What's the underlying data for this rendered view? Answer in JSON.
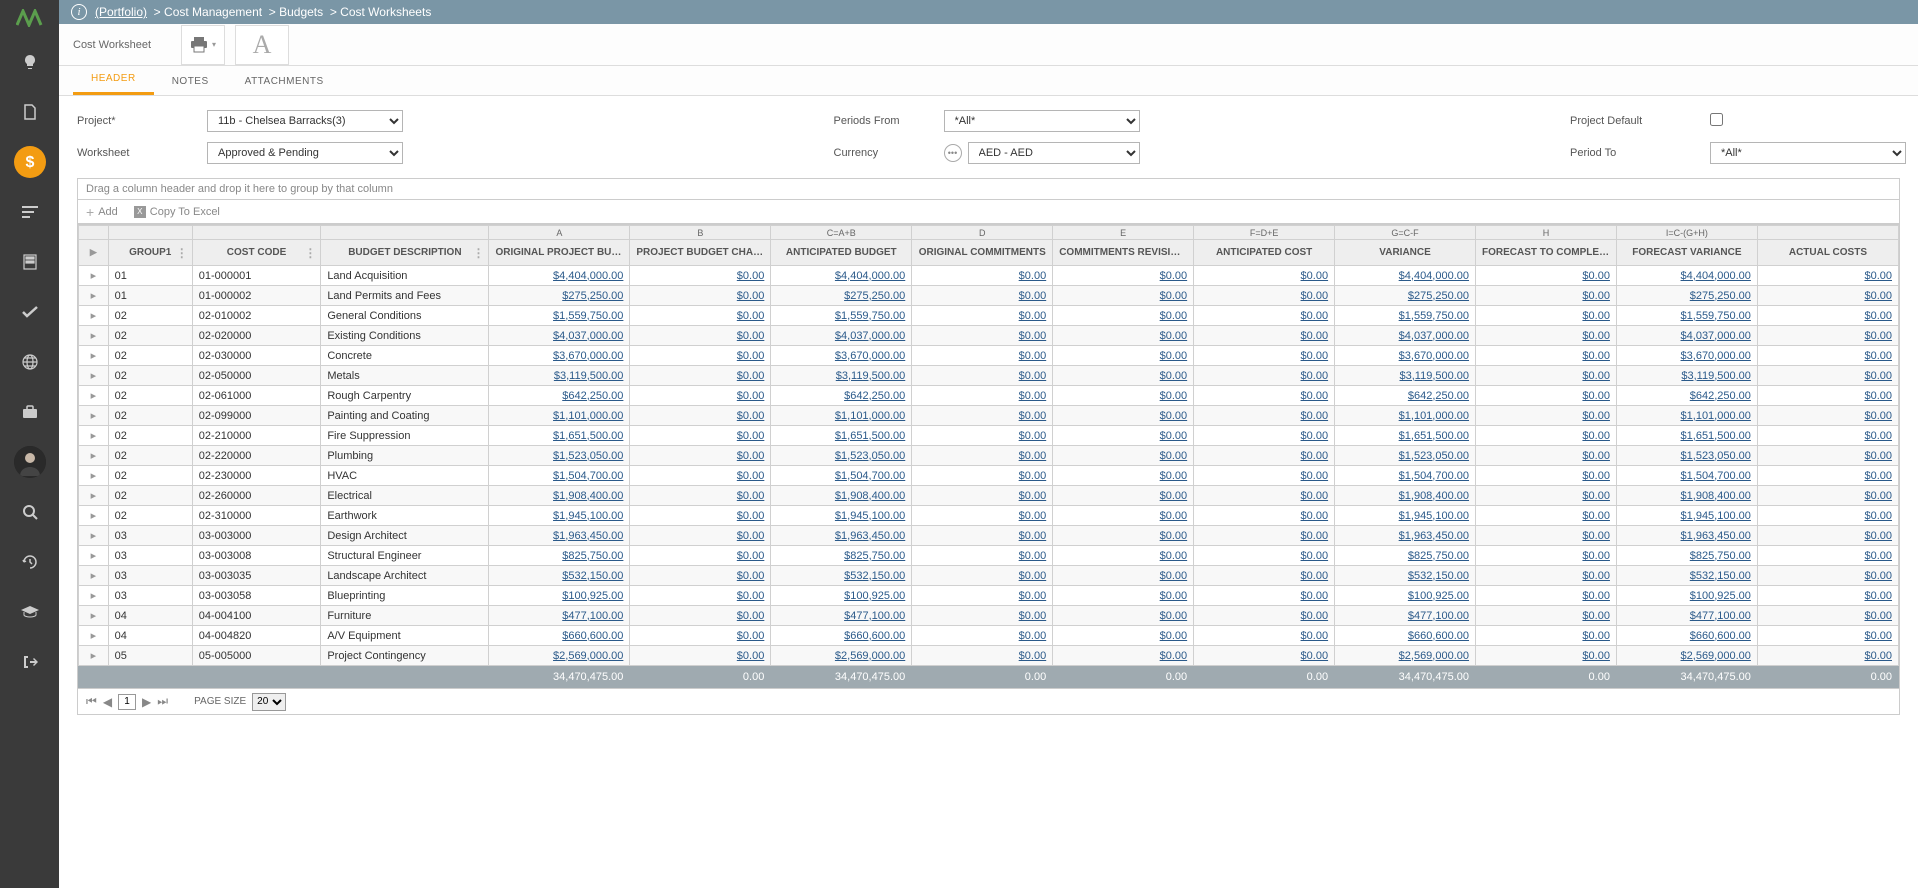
{
  "breadcrumb": {
    "portfolio": "(Portfolio)",
    "s1": "Cost Management",
    "s2": "Budgets",
    "s3": "Cost Worksheets"
  },
  "toolbar": {
    "title": "Cost Worksheet"
  },
  "tabs": {
    "header": "HEADER",
    "notes": "NOTES",
    "attachments": "ATTACHMENTS"
  },
  "filters": {
    "project_lbl": "Project*",
    "project_val": "11b - Chelsea Barracks(3)",
    "worksheet_lbl": "Worksheet",
    "worksheet_val": "Approved & Pending",
    "periods_lbl": "Periods From",
    "periods_val": "*All*",
    "currency_lbl": "Currency",
    "currency_val": "AED - AED",
    "projdef_lbl": "Project Default",
    "periodto_lbl": "Period To",
    "periodto_val": "*All*"
  },
  "group_hint": "Drag a column header and drop it here to group by that column",
  "actions": {
    "add": "Add",
    "copy": "Copy To Excel"
  },
  "formulas": [
    "",
    "",
    "",
    "",
    "A",
    "B",
    "C=A+B",
    "D",
    "E",
    "F=D+E",
    "G=C-F",
    "H",
    "I=C-(G+H)",
    ""
  ],
  "headers": [
    "",
    "GROUP1",
    "COST CODE",
    "BUDGET DESCRIPTION",
    "ORIGINAL PROJECT BUDGET",
    "PROJECT BUDGET CHANGES",
    "ANTICIPATED BUDGET",
    "ORIGINAL COMMITMENTS",
    "COMMITMENTS REVISIONS",
    "ANTICIPATED COST",
    "VARIANCE",
    "FORECAST TO COMPLETE",
    "FORECAST VARIANCE",
    "ACTUAL COSTS"
  ],
  "rows": [
    {
      "g": "01",
      "code": "01-000001",
      "desc": "Land Acquisition",
      "a": "$4,404,000.00",
      "b": "$0.00",
      "c": "$4,404,000.00",
      "d": "$0.00",
      "e": "$0.00",
      "f": "$0.00",
      "gg": "$4,404,000.00",
      "h": "$0.00",
      "i": "$4,404,000.00",
      "j": "$0.00"
    },
    {
      "g": "01",
      "code": "01-000002",
      "desc": "Land Permits and Fees",
      "a": "$275,250.00",
      "b": "$0.00",
      "c": "$275,250.00",
      "d": "$0.00",
      "e": "$0.00",
      "f": "$0.00",
      "gg": "$275,250.00",
      "h": "$0.00",
      "i": "$275,250.00",
      "j": "$0.00"
    },
    {
      "g": "02",
      "code": "02-010002",
      "desc": "General Conditions",
      "a": "$1,559,750.00",
      "b": "$0.00",
      "c": "$1,559,750.00",
      "d": "$0.00",
      "e": "$0.00",
      "f": "$0.00",
      "gg": "$1,559,750.00",
      "h": "$0.00",
      "i": "$1,559,750.00",
      "j": "$0.00"
    },
    {
      "g": "02",
      "code": "02-020000",
      "desc": "Existing Conditions",
      "a": "$4,037,000.00",
      "b": "$0.00",
      "c": "$4,037,000.00",
      "d": "$0.00",
      "e": "$0.00",
      "f": "$0.00",
      "gg": "$4,037,000.00",
      "h": "$0.00",
      "i": "$4,037,000.00",
      "j": "$0.00"
    },
    {
      "g": "02",
      "code": "02-030000",
      "desc": "Concrete",
      "a": "$3,670,000.00",
      "b": "$0.00",
      "c": "$3,670,000.00",
      "d": "$0.00",
      "e": "$0.00",
      "f": "$0.00",
      "gg": "$3,670,000.00",
      "h": "$0.00",
      "i": "$3,670,000.00",
      "j": "$0.00"
    },
    {
      "g": "02",
      "code": "02-050000",
      "desc": "Metals",
      "a": "$3,119,500.00",
      "b": "$0.00",
      "c": "$3,119,500.00",
      "d": "$0.00",
      "e": "$0.00",
      "f": "$0.00",
      "gg": "$3,119,500.00",
      "h": "$0.00",
      "i": "$3,119,500.00",
      "j": "$0.00"
    },
    {
      "g": "02",
      "code": "02-061000",
      "desc": "Rough Carpentry",
      "a": "$642,250.00",
      "b": "$0.00",
      "c": "$642,250.00",
      "d": "$0.00",
      "e": "$0.00",
      "f": "$0.00",
      "gg": "$642,250.00",
      "h": "$0.00",
      "i": "$642,250.00",
      "j": "$0.00"
    },
    {
      "g": "02",
      "code": "02-099000",
      "desc": "Painting and Coating",
      "a": "$1,101,000.00",
      "b": "$0.00",
      "c": "$1,101,000.00",
      "d": "$0.00",
      "e": "$0.00",
      "f": "$0.00",
      "gg": "$1,101,000.00",
      "h": "$0.00",
      "i": "$1,101,000.00",
      "j": "$0.00"
    },
    {
      "g": "02",
      "code": "02-210000",
      "desc": "Fire Suppression",
      "a": "$1,651,500.00",
      "b": "$0.00",
      "c": "$1,651,500.00",
      "d": "$0.00",
      "e": "$0.00",
      "f": "$0.00",
      "gg": "$1,651,500.00",
      "h": "$0.00",
      "i": "$1,651,500.00",
      "j": "$0.00"
    },
    {
      "g": "02",
      "code": "02-220000",
      "desc": "Plumbing",
      "a": "$1,523,050.00",
      "b": "$0.00",
      "c": "$1,523,050.00",
      "d": "$0.00",
      "e": "$0.00",
      "f": "$0.00",
      "gg": "$1,523,050.00",
      "h": "$0.00",
      "i": "$1,523,050.00",
      "j": "$0.00"
    },
    {
      "g": "02",
      "code": "02-230000",
      "desc": "HVAC",
      "a": "$1,504,700.00",
      "b": "$0.00",
      "c": "$1,504,700.00",
      "d": "$0.00",
      "e": "$0.00",
      "f": "$0.00",
      "gg": "$1,504,700.00",
      "h": "$0.00",
      "i": "$1,504,700.00",
      "j": "$0.00"
    },
    {
      "g": "02",
      "code": "02-260000",
      "desc": "Electrical",
      "a": "$1,908,400.00",
      "b": "$0.00",
      "c": "$1,908,400.00",
      "d": "$0.00",
      "e": "$0.00",
      "f": "$0.00",
      "gg": "$1,908,400.00",
      "h": "$0.00",
      "i": "$1,908,400.00",
      "j": "$0.00"
    },
    {
      "g": "02",
      "code": "02-310000",
      "desc": "Earthwork",
      "a": "$1,945,100.00",
      "b": "$0.00",
      "c": "$1,945,100.00",
      "d": "$0.00",
      "e": "$0.00",
      "f": "$0.00",
      "gg": "$1,945,100.00",
      "h": "$0.00",
      "i": "$1,945,100.00",
      "j": "$0.00"
    },
    {
      "g": "03",
      "code": "03-003000",
      "desc": "Design Architect",
      "a": "$1,963,450.00",
      "b": "$0.00",
      "c": "$1,963,450.00",
      "d": "$0.00",
      "e": "$0.00",
      "f": "$0.00",
      "gg": "$1,963,450.00",
      "h": "$0.00",
      "i": "$1,963,450.00",
      "j": "$0.00"
    },
    {
      "g": "03",
      "code": "03-003008",
      "desc": "Structural Engineer",
      "a": "$825,750.00",
      "b": "$0.00",
      "c": "$825,750.00",
      "d": "$0.00",
      "e": "$0.00",
      "f": "$0.00",
      "gg": "$825,750.00",
      "h": "$0.00",
      "i": "$825,750.00",
      "j": "$0.00"
    },
    {
      "g": "03",
      "code": "03-003035",
      "desc": "Landscape Architect",
      "a": "$532,150.00",
      "b": "$0.00",
      "c": "$532,150.00",
      "d": "$0.00",
      "e": "$0.00",
      "f": "$0.00",
      "gg": "$532,150.00",
      "h": "$0.00",
      "i": "$532,150.00",
      "j": "$0.00"
    },
    {
      "g": "03",
      "code": "03-003058",
      "desc": "Blueprinting",
      "a": "$100,925.00",
      "b": "$0.00",
      "c": "$100,925.00",
      "d": "$0.00",
      "e": "$0.00",
      "f": "$0.00",
      "gg": "$100,925.00",
      "h": "$0.00",
      "i": "$100,925.00",
      "j": "$0.00"
    },
    {
      "g": "04",
      "code": "04-004100",
      "desc": "Furniture",
      "a": "$477,100.00",
      "b": "$0.00",
      "c": "$477,100.00",
      "d": "$0.00",
      "e": "$0.00",
      "f": "$0.00",
      "gg": "$477,100.00",
      "h": "$0.00",
      "i": "$477,100.00",
      "j": "$0.00"
    },
    {
      "g": "04",
      "code": "04-004820",
      "desc": "A/V Equipment",
      "a": "$660,600.00",
      "b": "$0.00",
      "c": "$660,600.00",
      "d": "$0.00",
      "e": "$0.00",
      "f": "$0.00",
      "gg": "$660,600.00",
      "h": "$0.00",
      "i": "$660,600.00",
      "j": "$0.00"
    },
    {
      "g": "05",
      "code": "05-005000",
      "desc": "Project Contingency",
      "a": "$2,569,000.00",
      "b": "$0.00",
      "c": "$2,569,000.00",
      "d": "$0.00",
      "e": "$0.00",
      "f": "$0.00",
      "gg": "$2,569,000.00",
      "h": "$0.00",
      "i": "$2,569,000.00",
      "j": "$0.00"
    }
  ],
  "totals": [
    "",
    "",
    "",
    "",
    "34,470,475.00",
    "0.00",
    "34,470,475.00",
    "0.00",
    "0.00",
    "0.00",
    "34,470,475.00",
    "0.00",
    "34,470,475.00",
    "0.00"
  ],
  "pager": {
    "page": "1",
    "size_lbl": "PAGE SIZE",
    "size": "20"
  }
}
